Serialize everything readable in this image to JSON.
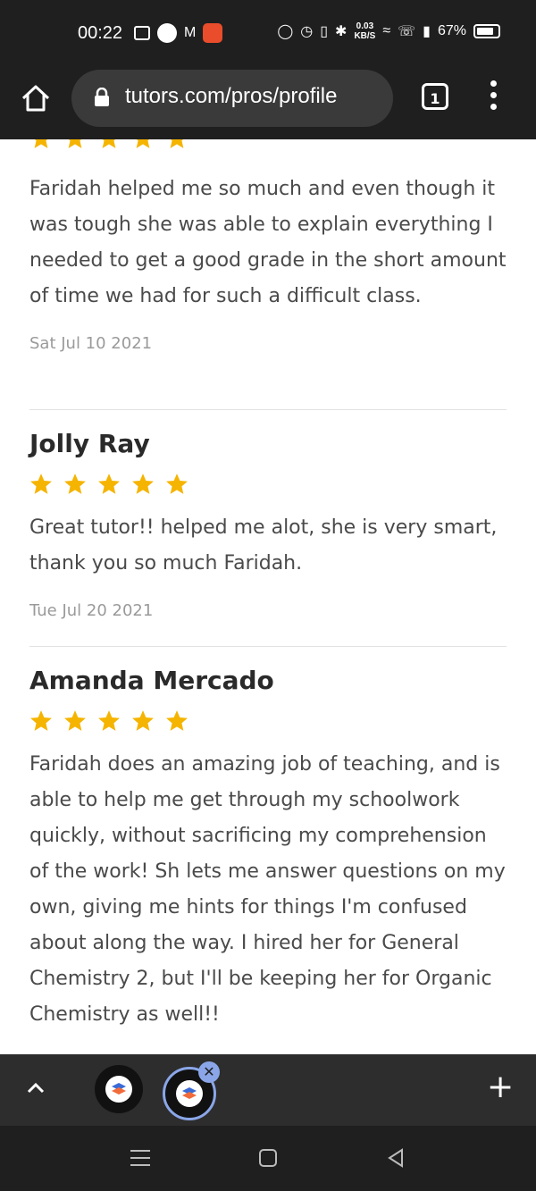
{
  "status_bar": {
    "time": "00:22",
    "net_speed_value": "0.03",
    "net_speed_unit": "KB/S",
    "battery": "67%"
  },
  "browser": {
    "url": "tutors.com/pros/profile",
    "tab_count": "1"
  },
  "reviews": [
    {
      "name": "",
      "rating": 5,
      "text": "Faridah helped me so much and even though it was tough she was able to explain everything I needed to get a good grade in the short amount of time we had for such a difficult class.",
      "date": "Sat Jul 10 2021"
    },
    {
      "name": "Jolly Ray",
      "rating": 5,
      "text": "Great tutor!! helped me alot, she is very smart, thank you so much Faridah.",
      "date": "Tue Jul 20 2021"
    },
    {
      "name": "Amanda Mercado",
      "rating": 5,
      "text": "Faridah does an amazing job of teaching, and is able to help me get through my schoolwork quickly, without sacrificing my comprehension of the work! Sh lets me answer questions on my own, giving me hints for things I'm confused about along the way. I hired her for General Chemistry 2, but I'll be keeping her for Organic Chemistry as well!!",
      "date": ""
    }
  ],
  "colors": {
    "star": "#f5b400",
    "toolbar": "#1f1f1f",
    "tab_accent": "#8aa6e8"
  },
  "icons": {
    "home": "home-icon",
    "lock": "lock-icon",
    "menu": "more-vert-icon",
    "chevron": "chevron-up-icon",
    "plus": "plus-icon"
  }
}
